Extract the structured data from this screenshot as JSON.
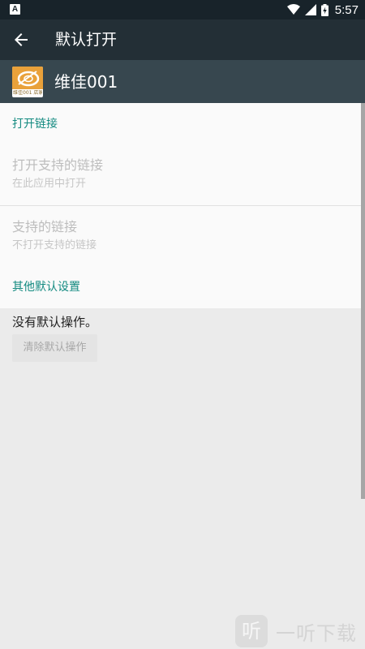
{
  "status_bar": {
    "notification_icon_letter": "A",
    "time": "5:57",
    "icons": [
      "wifi-icon",
      "signal-icon",
      "battery-charging-icon"
    ]
  },
  "toolbar": {
    "back_icon": "arrow-left-icon",
    "title": "默认打开"
  },
  "app": {
    "name": "维佳001",
    "icon_text": "维佳001 店家"
  },
  "open_links": {
    "section_title": "打开链接",
    "open_supported_links": {
      "title": "打开支持的链接",
      "summary": "在此应用中打开"
    },
    "supported_links": {
      "title": "支持的链接",
      "summary": "不打开支持的链接"
    }
  },
  "other_defaults": {
    "section_title": "其他默认设置",
    "status_text": "没有默认操作。",
    "clear_button_label": "清除默认操作"
  },
  "watermark": {
    "logo_char": "听",
    "text": "一听下载"
  },
  "colors": {
    "status_bar": "#18232a",
    "toolbar": "#232f36",
    "app_header": "#37474f",
    "accent": "#138a80",
    "background": "#ebebeb",
    "panel": "#fafafa"
  }
}
